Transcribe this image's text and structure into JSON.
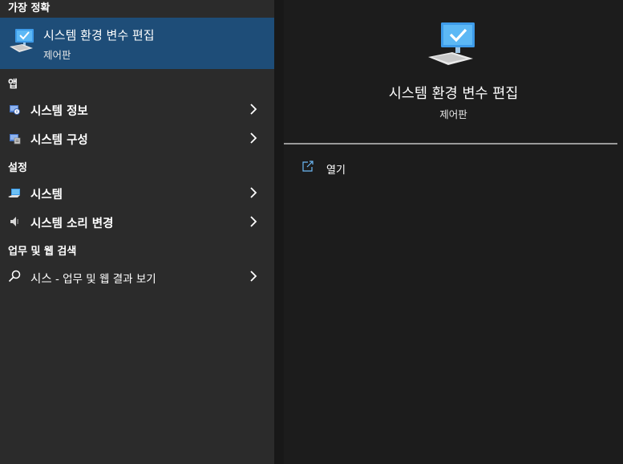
{
  "left": {
    "best_match_header": "가장 정확",
    "best_match": {
      "title": "시스템 환경 변수 편집",
      "subtitle": "제어판"
    },
    "apps_header": "앱",
    "apps": [
      {
        "label": "시스템 정보"
      },
      {
        "label": "시스템 구성"
      }
    ],
    "settings_header": "설정",
    "settings": [
      {
        "label": "시스템"
      },
      {
        "label": "시스템 소리 변경"
      }
    ],
    "web_header": "업무 및 웹 검색",
    "web": {
      "query": "시스",
      "suffix": " - 업무 및 웹 결과 보기"
    }
  },
  "right": {
    "title": "시스템 환경 변수 편집",
    "subtitle": "제어판",
    "actions": [
      {
        "label": "열기",
        "icon": "open-external-icon"
      }
    ]
  },
  "colors": {
    "selected_bg": "#1e4d78",
    "left_bg": "#2b2b2b",
    "right_bg": "#1c1c1c"
  }
}
